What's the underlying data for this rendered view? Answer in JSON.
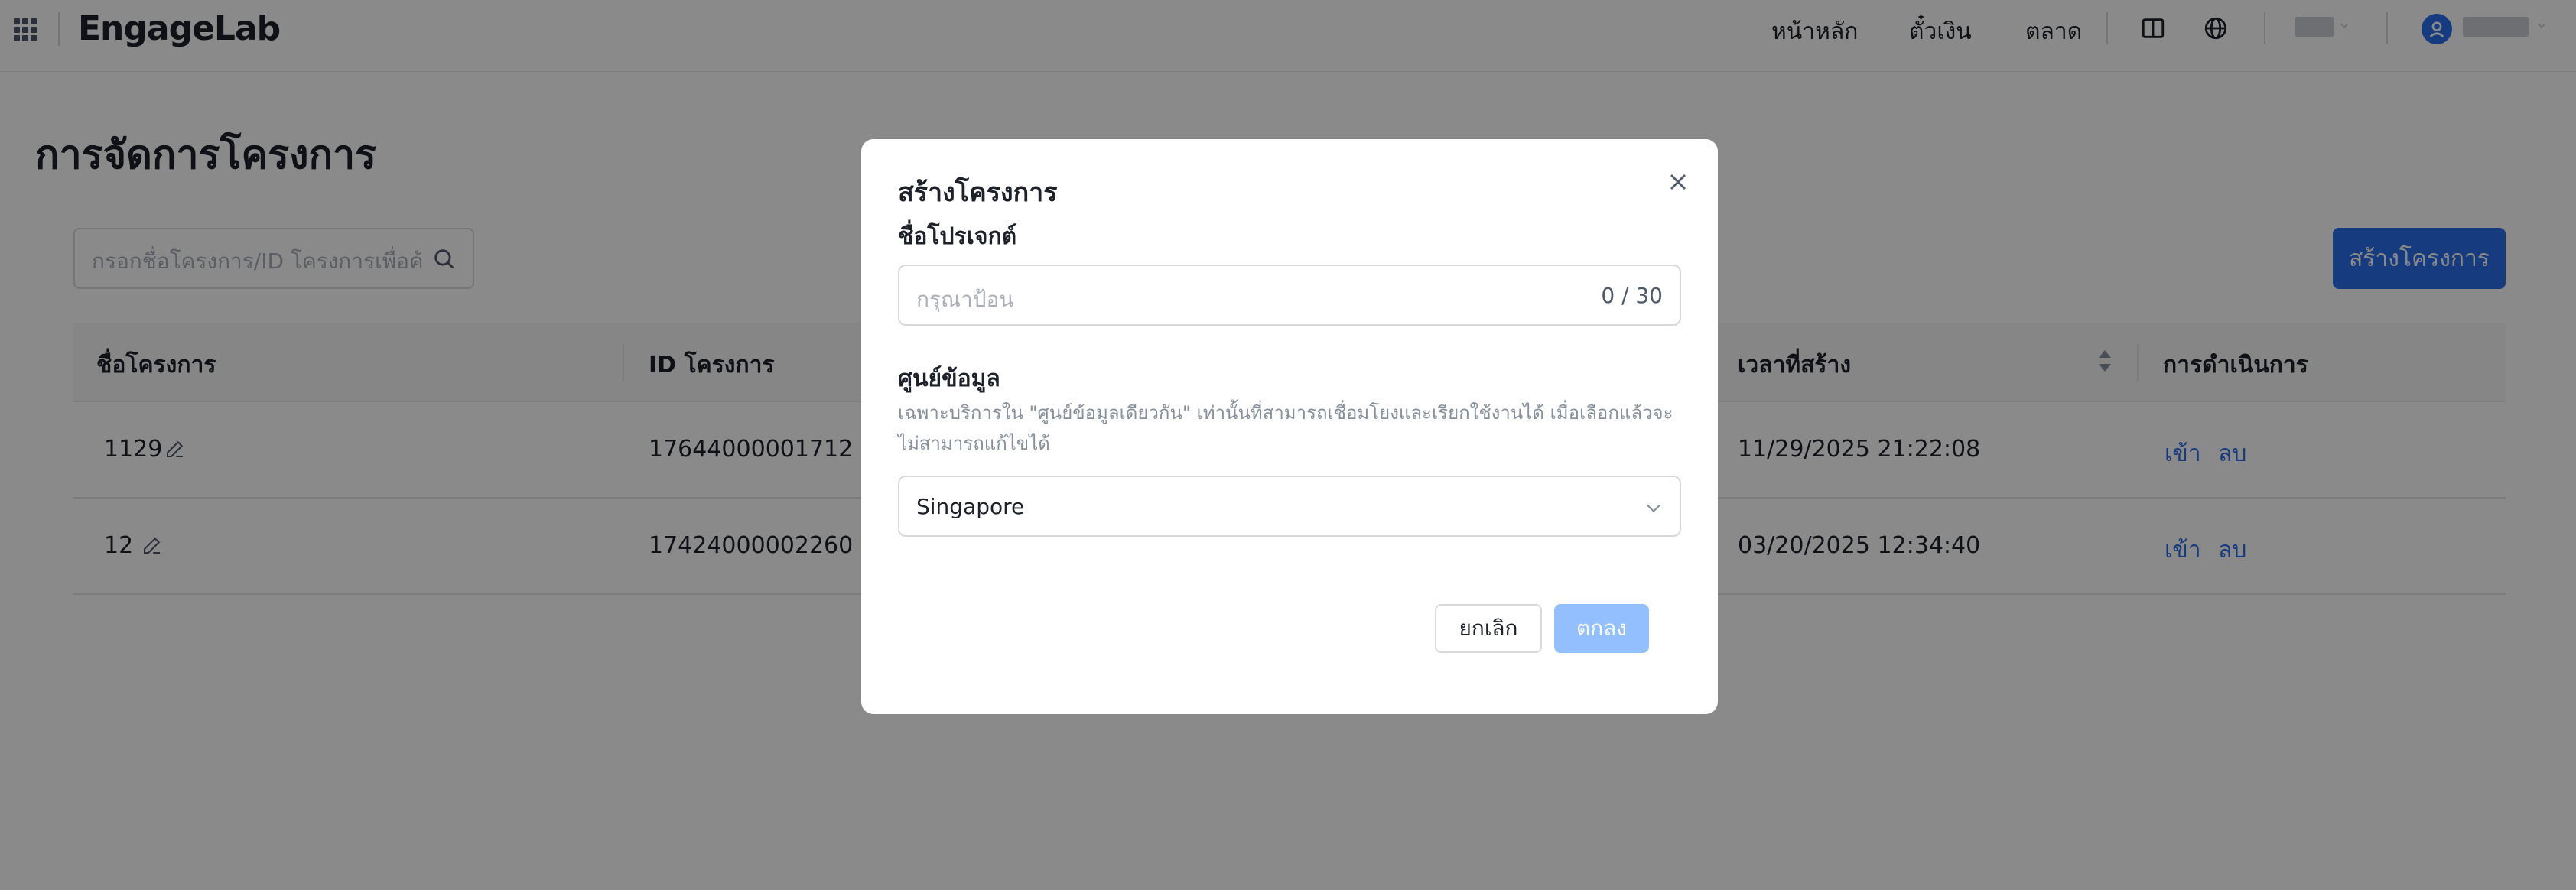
{
  "header": {
    "logo": "EngageLab",
    "nav": [
      "หน้าหลัก",
      "ตั๋วเงิน",
      "ตลาด"
    ],
    "icons": [
      "apps-grid-icon",
      "layout-icon",
      "globe-icon",
      "user-avatar-icon"
    ]
  },
  "page": {
    "title": "การจัดการโครงการ",
    "search_placeholder": "กรอกชื่อโครงการ/ID โครงการเพื่อค้...",
    "create_button": "สร้างโครงการ"
  },
  "table": {
    "columns": [
      "ชื่อโครงการ",
      "ID โครงการ",
      "เวลาที่สร้าง",
      "การดำเนินการ"
    ],
    "rows": [
      {
        "name": "1129",
        "id": "17644000001712",
        "created": "11/29/2025 21:22:08",
        "enter": "เข้า",
        "delete": "ลบ"
      },
      {
        "name": "12",
        "id": "17424000002260",
        "created": "03/20/2025 12:34:40",
        "enter": "เข้า",
        "delete": "ลบ"
      }
    ]
  },
  "modal": {
    "title": "สร้างโครงการ",
    "name_label": "ชื่อโปรเจกต์",
    "name_placeholder": "กรุณาป้อน",
    "name_counter": "0 / 30",
    "datacenter_label": "ศูนย์ข้อมูล",
    "datacenter_hint": "เฉพาะบริการใน \"ศูนย์ข้อมูลเดียวกัน\" เท่านั้นที่สามารถเชื่อมโยงและเรียกใช้งานได้ เมื่อเลือกแล้วจะไม่สามารถแก้ไขได้",
    "datacenter_value": "Singapore",
    "cancel": "ยกเลิก",
    "ok": "ตกลง"
  },
  "colors": {
    "primary": "#2a6ee9",
    "primary_disabled": "#94bfff",
    "overlay": "rgba(0,0,0,0.46)"
  }
}
